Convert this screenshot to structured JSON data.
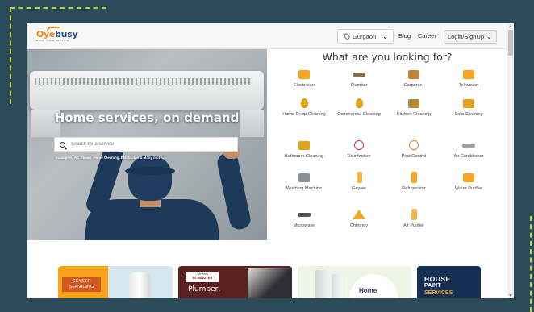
{
  "navbar": {
    "logo_word_pre": "Oye",
    "logo_word_post": "busy",
    "logo_tagline": "BOOK YOUR SERVICE",
    "location": "Gurgaon",
    "links": [
      "Blog",
      "Career"
    ],
    "login": "Login/SignUp"
  },
  "hero": {
    "title": "Home services, on demand",
    "search_placeholder": "Search for a service",
    "examples": "Examples: AC Repair, Home Cleaning, Electrician & Many more..."
  },
  "services": {
    "title": "What are you looking for?",
    "items": [
      {
        "label": "Electrician",
        "icon": "electrician-drill-icon",
        "color": "#f5a623"
      },
      {
        "label": "Plumber",
        "icon": "plumber-wrench-icon",
        "color": "#8a6d3b"
      },
      {
        "label": "Carpenter",
        "icon": "carpenter-tools-icon",
        "color": "#c0843a"
      },
      {
        "label": "Television",
        "icon": "television-icon",
        "color": "#f5a623"
      },
      {
        "label": "Home Deep Cleaning",
        "icon": "vacuum-icon",
        "color": "#e0a21a"
      },
      {
        "label": "Commercial Cleaning",
        "icon": "commercial-vacuum-icon",
        "color": "#e0a21a"
      },
      {
        "label": "Kitchen Cleaning",
        "icon": "kitchen-icon",
        "color": "#b58b3a"
      },
      {
        "label": "Sofa Cleaning",
        "icon": "sofa-icon",
        "color": "#e0a21a"
      },
      {
        "label": "Bathroom Cleaning",
        "icon": "bathroom-icon",
        "color": "#e0a21a"
      },
      {
        "label": "Disinfection",
        "icon": "disinfection-icon",
        "color": "#c0392b"
      },
      {
        "label": "Pest Control",
        "icon": "pest-control-icon",
        "color": "#e67e22"
      },
      {
        "label": "Air Conditioner",
        "icon": "air-conditioner-icon",
        "color": "#9aa0a6"
      },
      {
        "label": "Washing Machine",
        "icon": "washing-machine-icon",
        "color": "#8a8f94"
      },
      {
        "label": "Geyser",
        "icon": "geyser-icon",
        "color": "#f0b84a"
      },
      {
        "label": "Refrigerator",
        "icon": "refrigerator-icon",
        "color": "#f5a623"
      },
      {
        "label": "Water Purifier",
        "icon": "water-purifier-icon",
        "color": "#f5a623"
      },
      {
        "label": "Microwave",
        "icon": "microwave-icon",
        "color": "#555555"
      },
      {
        "label": "Chimney",
        "icon": "chimney-icon",
        "color": "#f5a623"
      },
      {
        "label": "Air Purifier",
        "icon": "air-purifier-icon",
        "color": "#f0b84a"
      }
    ]
  },
  "banners": {
    "geyser_line1": "GEYSER",
    "geyser_line2": "SERVICING",
    "plumber_chip_top": "Services",
    "plumber_chip_mid": "60 MINUTES",
    "plumber_big": "Plumber,",
    "home_text": "Home",
    "paint_line1": "HOUSE",
    "paint_line2": "PAINT",
    "paint_line3": "SERVICES"
  },
  "colors": {
    "accent": "#f28c1e",
    "brand_dark": "#1e4a75",
    "page_bg": "#2b4a5a",
    "dash": "#c7d12b"
  }
}
